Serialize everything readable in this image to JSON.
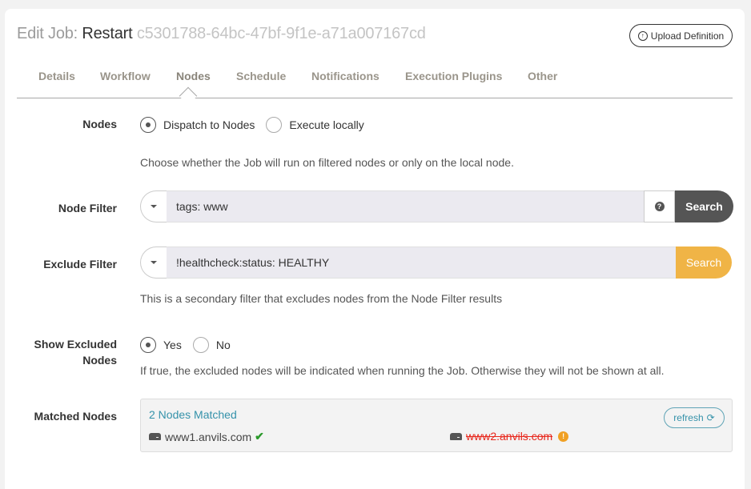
{
  "header": {
    "prefix": "Edit Job:",
    "job_name": "Restart",
    "job_uuid": "c5301788-64bc-47bf-9f1e-a71a007167cd",
    "upload_button": "Upload Definition",
    "upload_icon": "circle-arrow-up-icon"
  },
  "tabs": [
    {
      "label": "Details",
      "active": false
    },
    {
      "label": "Workflow",
      "active": false
    },
    {
      "label": "Nodes",
      "active": true
    },
    {
      "label": "Schedule",
      "active": false
    },
    {
      "label": "Notifications",
      "active": false
    },
    {
      "label": "Execution Plugins",
      "active": false
    },
    {
      "label": "Other",
      "active": false
    }
  ],
  "nodes_section": {
    "label": "Nodes",
    "options": [
      {
        "label": "Dispatch to Nodes",
        "selected": true
      },
      {
        "label": "Execute locally",
        "selected": false
      }
    ],
    "help": "Choose whether the Job will run on filtered nodes or only on the local node."
  },
  "node_filter": {
    "label": "Node Filter",
    "value": "tags: www",
    "help_icon": "question-circle-icon",
    "search_button": "Search"
  },
  "exclude_filter": {
    "label": "Exclude Filter",
    "value": "!healthcheck:status: HEALTHY",
    "search_button": "Search",
    "help": "This is a secondary filter that excludes nodes from the Node Filter results"
  },
  "show_excluded": {
    "label_line1": "Show Excluded",
    "label_line2": "Nodes",
    "options": [
      {
        "label": "Yes",
        "selected": true
      },
      {
        "label": "No",
        "selected": false
      }
    ],
    "help": "If true, the excluded nodes will be indicated when running the Job. Otherwise they will not be shown at all."
  },
  "matched_nodes": {
    "label": "Matched Nodes",
    "count_text": "2 Nodes Matched",
    "refresh_button": "refresh",
    "nodes": [
      {
        "name": "www1.anvils.com",
        "status": "included",
        "status_icon": "check-icon"
      },
      {
        "name": "www2.anvils.com",
        "status": "excluded",
        "status_icon": "exclamation-circle-icon"
      }
    ]
  },
  "colors": {
    "accent_link": "#3592aa",
    "search_dark": "#555555",
    "search_warning": "#f0b446",
    "excluded_text": "#e8271c",
    "included_check": "#2b9a2b"
  }
}
